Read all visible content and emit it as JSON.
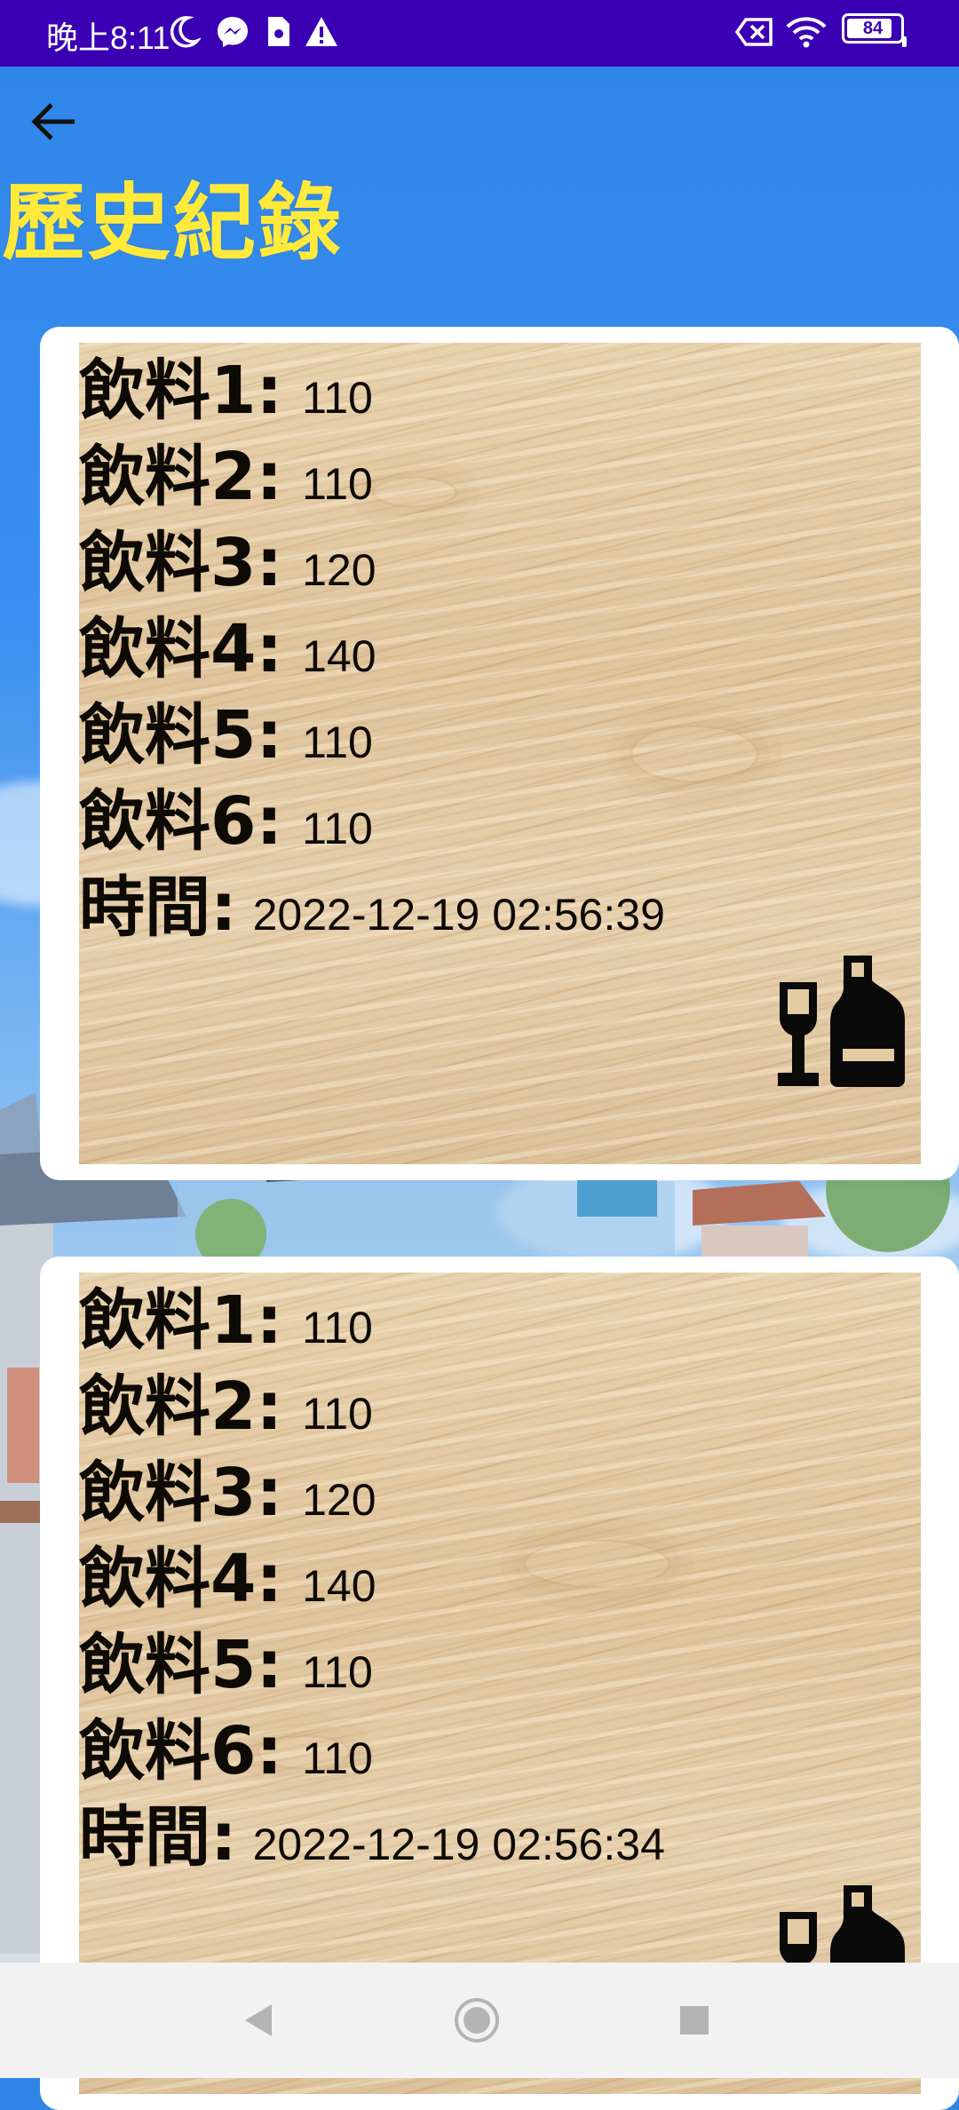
{
  "status_bar": {
    "time": "晚上8:11",
    "icons": [
      "moon-icon",
      "messenger-icon",
      "sim-card-icon",
      "warning-icon",
      "no-signal-icon",
      "wifi-icon"
    ],
    "battery_level": "84"
  },
  "header": {
    "back_icon": "arrow-left-icon",
    "title": "歷史紀錄"
  },
  "records": [
    {
      "items": [
        {
          "label": "飲料1:",
          "value": "110"
        },
        {
          "label": "飲料2:",
          "value": "110"
        },
        {
          "label": "飲料3:",
          "value": "120"
        },
        {
          "label": "飲料4:",
          "value": "140"
        },
        {
          "label": "飲料5:",
          "value": "110"
        },
        {
          "label": "飲料6:",
          "value": "110"
        }
      ],
      "time_label": "時間:",
      "time_value": "2022-12-19 02:56:39",
      "icon": "drinks-icon"
    },
    {
      "items": [
        {
          "label": "飲料1:",
          "value": "110"
        },
        {
          "label": "飲料2:",
          "value": "110"
        },
        {
          "label": "飲料3:",
          "value": "120"
        },
        {
          "label": "飲料4:",
          "value": "140"
        },
        {
          "label": "飲料5:",
          "value": "110"
        },
        {
          "label": "飲料6:",
          "value": "110"
        }
      ],
      "time_label": "時間:",
      "time_value": "2022-12-19 02:56:34",
      "icon": "drinks-icon"
    }
  ],
  "nav_bar": {
    "icons": [
      "nav-back-icon",
      "nav-home-icon",
      "nav-recents-icon"
    ]
  },
  "colors": {
    "status_bar": "#3b00b3",
    "title": "#ffe93b",
    "background": "#2f86e8",
    "card": "#ffffff"
  }
}
